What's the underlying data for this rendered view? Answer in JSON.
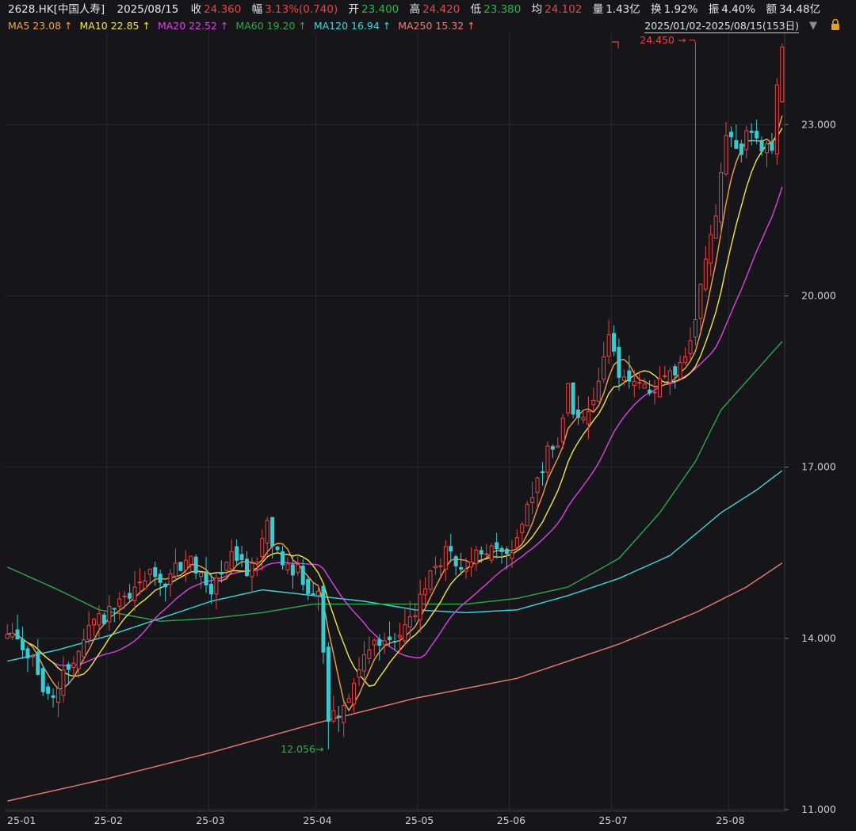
{
  "header": {
    "symbol": "2628.HK[中国人寿]",
    "date": "2025/08/15",
    "close_label": "收",
    "close": "24.360",
    "change_label": "幅",
    "change": "3.13%(0.740)",
    "open_label": "开",
    "open": "23.400",
    "high_label": "高",
    "high": "24.420",
    "low_label": "低",
    "low": "23.380",
    "avg_label": "均",
    "avg": "24.102",
    "vol_label": "量",
    "volume": "1.43亿",
    "turn_label": "换",
    "turnover_rate": "1.92%",
    "amp_label": "振",
    "amplitude": "4.40%",
    "amt_label": "额",
    "amount": "34.48亿"
  },
  "ma_legend": [
    {
      "label": "MA5 23.08",
      "arrow": "↑",
      "color": "#f5a04a"
    },
    {
      "label": "MA10 22.85",
      "arrow": "↑",
      "color": "#f3e64a"
    },
    {
      "label": "MA20 22.52",
      "arrow": "↑",
      "color": "#e040e8"
    },
    {
      "label": "MA60 19.20",
      "arrow": "↑",
      "color": "#2ea84c"
    },
    {
      "label": "MA120 16.94",
      "arrow": "↑",
      "color": "#3fd6dc"
    },
    {
      "label": "MA250 15.32",
      "arrow": "↑",
      "color": "#ef7c72"
    }
  ],
  "range_label": "2025/01/02-2025/08/15(153日)",
  "icons": {
    "caret": "triangle-down-icon",
    "lock": "lock-icon"
  },
  "colors": {
    "up": "#e64545",
    "down": "#3fc9cf",
    "background": "#16161a",
    "grid": "#2a2a30",
    "axis_text": "#cfcfcf",
    "max_annotation": "#e64545",
    "min_annotation": "#2fb34a"
  },
  "chart_data": {
    "type": "candlestick",
    "ylim": [
      11,
      24.6
    ],
    "yticks": [
      "23.000",
      "20.000",
      "17.000",
      "14.000",
      "11.000"
    ],
    "ytick_values": [
      23,
      20,
      17,
      14,
      11
    ],
    "x_month_labels": [
      "25-01",
      "25-02",
      "25-03",
      "25-04",
      "25-05",
      "25-06",
      "25-07",
      "25-08"
    ],
    "max_annotation": {
      "label": "24.450",
      "value": 24.45,
      "month": "25-07"
    },
    "min_annotation": {
      "label": "12.056",
      "value": 12.056,
      "month": "25-04"
    },
    "days": 153,
    "month_start_index": [
      0,
      20,
      40,
      61,
      81,
      99,
      119,
      142
    ],
    "anchors": {
      "close": [
        [
          0,
          14.15
        ],
        [
          5,
          13.6
        ],
        [
          8,
          12.9
        ],
        [
          12,
          13.5
        ],
        [
          15,
          14.1
        ],
        [
          20,
          14.4
        ],
        [
          24,
          14.75
        ],
        [
          28,
          15.3
        ],
        [
          31,
          14.95
        ],
        [
          35,
          15.4
        ],
        [
          40,
          14.95
        ],
        [
          44,
          15.45
        ],
        [
          48,
          15.15
        ],
        [
          51,
          15.9
        ],
        [
          53,
          15.55
        ],
        [
          56,
          15.25
        ],
        [
          59,
          14.95
        ],
        [
          61,
          14.75
        ],
        [
          63,
          12.6
        ],
        [
          65,
          12.75
        ],
        [
          68,
          13.3
        ],
        [
          72,
          13.8
        ],
        [
          76,
          13.85
        ],
        [
          80,
          14.5
        ],
        [
          83,
          15.2
        ],
        [
          86,
          15.45
        ],
        [
          89,
          15.25
        ],
        [
          92,
          15.45
        ],
        [
          96,
          15.6
        ],
        [
          99,
          15.4
        ],
        [
          102,
          16.2
        ],
        [
          106,
          17.2
        ],
        [
          108,
          17.5
        ],
        [
          110,
          18.3
        ],
        [
          113,
          17.7
        ],
        [
          116,
          18.5
        ],
        [
          118,
          19.2
        ],
        [
          120,
          18.7
        ],
        [
          124,
          18.5
        ],
        [
          127,
          18.3
        ],
        [
          130,
          18.55
        ],
        [
          133,
          18.9
        ],
        [
          136,
          20.1
        ],
        [
          139,
          21.3
        ],
        [
          141,
          22.8
        ],
        [
          143,
          22.5
        ],
        [
          146,
          22.9
        ],
        [
          148,
          22.4
        ],
        [
          150,
          22.7
        ],
        [
          152,
          24.36
        ]
      ],
      "ma60": [
        [
          0,
          15.25
        ],
        [
          10,
          14.85
        ],
        [
          18,
          14.5
        ],
        [
          30,
          14.3
        ],
        [
          40,
          14.35
        ],
        [
          50,
          14.45
        ],
        [
          60,
          14.6
        ],
        [
          75,
          14.6
        ],
        [
          90,
          14.6
        ],
        [
          100,
          14.7
        ],
        [
          110,
          14.9
        ],
        [
          120,
          15.4
        ],
        [
          128,
          16.2
        ],
        [
          135,
          17.1
        ],
        [
          140,
          18.0
        ],
        [
          147,
          18.7
        ],
        [
          152,
          19.2
        ]
      ],
      "ma120": [
        [
          0,
          13.6
        ],
        [
          10,
          13.8
        ],
        [
          20,
          14.05
        ],
        [
          30,
          14.35
        ],
        [
          40,
          14.65
        ],
        [
          50,
          14.85
        ],
        [
          60,
          14.75
        ],
        [
          70,
          14.65
        ],
        [
          80,
          14.5
        ],
        [
          90,
          14.45
        ],
        [
          100,
          14.5
        ],
        [
          110,
          14.75
        ],
        [
          120,
          15.05
        ],
        [
          130,
          15.45
        ],
        [
          140,
          16.2
        ],
        [
          147,
          16.6
        ],
        [
          152,
          16.94
        ]
      ],
      "ma250": [
        [
          0,
          11.15
        ],
        [
          20,
          11.55
        ],
        [
          40,
          12.0
        ],
        [
          60,
          12.5
        ],
        [
          80,
          12.95
        ],
        [
          100,
          13.3
        ],
        [
          120,
          13.9
        ],
        [
          135,
          14.45
        ],
        [
          145,
          14.9
        ],
        [
          152,
          15.32
        ]
      ]
    }
  }
}
